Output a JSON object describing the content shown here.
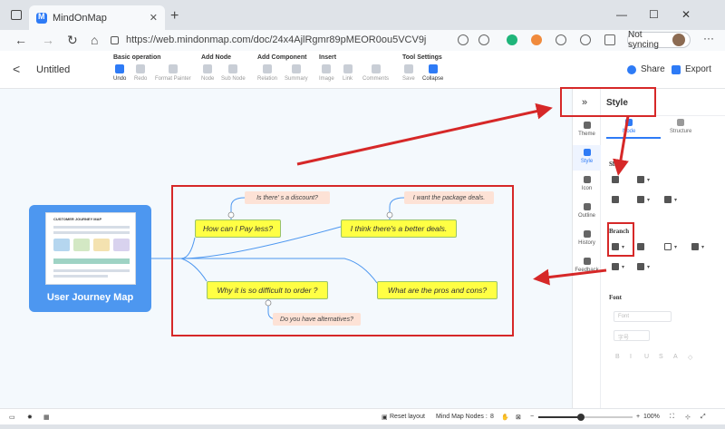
{
  "browser": {
    "tab_title": "MindOnMap",
    "tab_close": "✕",
    "new_tab": "+",
    "url": "https://web.mindonmap.com/doc/24x4AjlRgmr89pMEOR0ou5VCV9j",
    "sync_label": "Not syncing",
    "window_controls": [
      "—",
      "☐",
      "✕"
    ],
    "nav": [
      "←",
      "→",
      "↻",
      "⌂"
    ]
  },
  "app": {
    "back": "<",
    "doc_title": "Untitled",
    "groups": [
      {
        "title": "Basic operation",
        "tools": [
          "Undo",
          "Redo",
          "Format Painter"
        ]
      },
      {
        "title": "Add Node",
        "tools": [
          "Node",
          "Sub Node"
        ]
      },
      {
        "title": "Add Component",
        "tools": [
          "Relation",
          "Summary"
        ]
      },
      {
        "title": "Insert",
        "tools": [
          "Image",
          "Link",
          "Comments"
        ]
      },
      {
        "title": "Tool Settings",
        "tools": [
          "Save",
          "Collapse"
        ]
      }
    ],
    "share": "Share",
    "export": "Export"
  },
  "sidebar": {
    "items": [
      "Theme",
      "Style",
      "Icon",
      "Outline",
      "History",
      "Feedback"
    ],
    "active": "Style"
  },
  "panel": {
    "collapse": "»",
    "title": "Style",
    "tabs": [
      "Node",
      "Structure"
    ],
    "shape_label": "Shape",
    "branch_label": "Branch",
    "font_label": "Font",
    "font_select": "Font",
    "font_size": "字号",
    "font_styles": [
      "B",
      "I",
      "U",
      "S",
      "A",
      "◇"
    ]
  },
  "mindmap": {
    "root_label": "User Journey Map",
    "thumb_title": "CUSTOMER JOURNEY MAP",
    "nodes": [
      "How can I Pay less?",
      "I think there's a better deals.",
      "Why it is so difficult to  order ?",
      "What are the pros and cons?"
    ],
    "subs": [
      "Is there' s a discount?",
      "I want the package deals.",
      "Do you have alternatives?"
    ],
    "accent": "#4d97f0",
    "highlight": "#d62828"
  },
  "status": {
    "reset_layout": "Reset layout",
    "node_count_label": "Mind Map Nodes :",
    "node_count": "8",
    "zoom": "100%",
    "zoom_level": 0.45
  }
}
